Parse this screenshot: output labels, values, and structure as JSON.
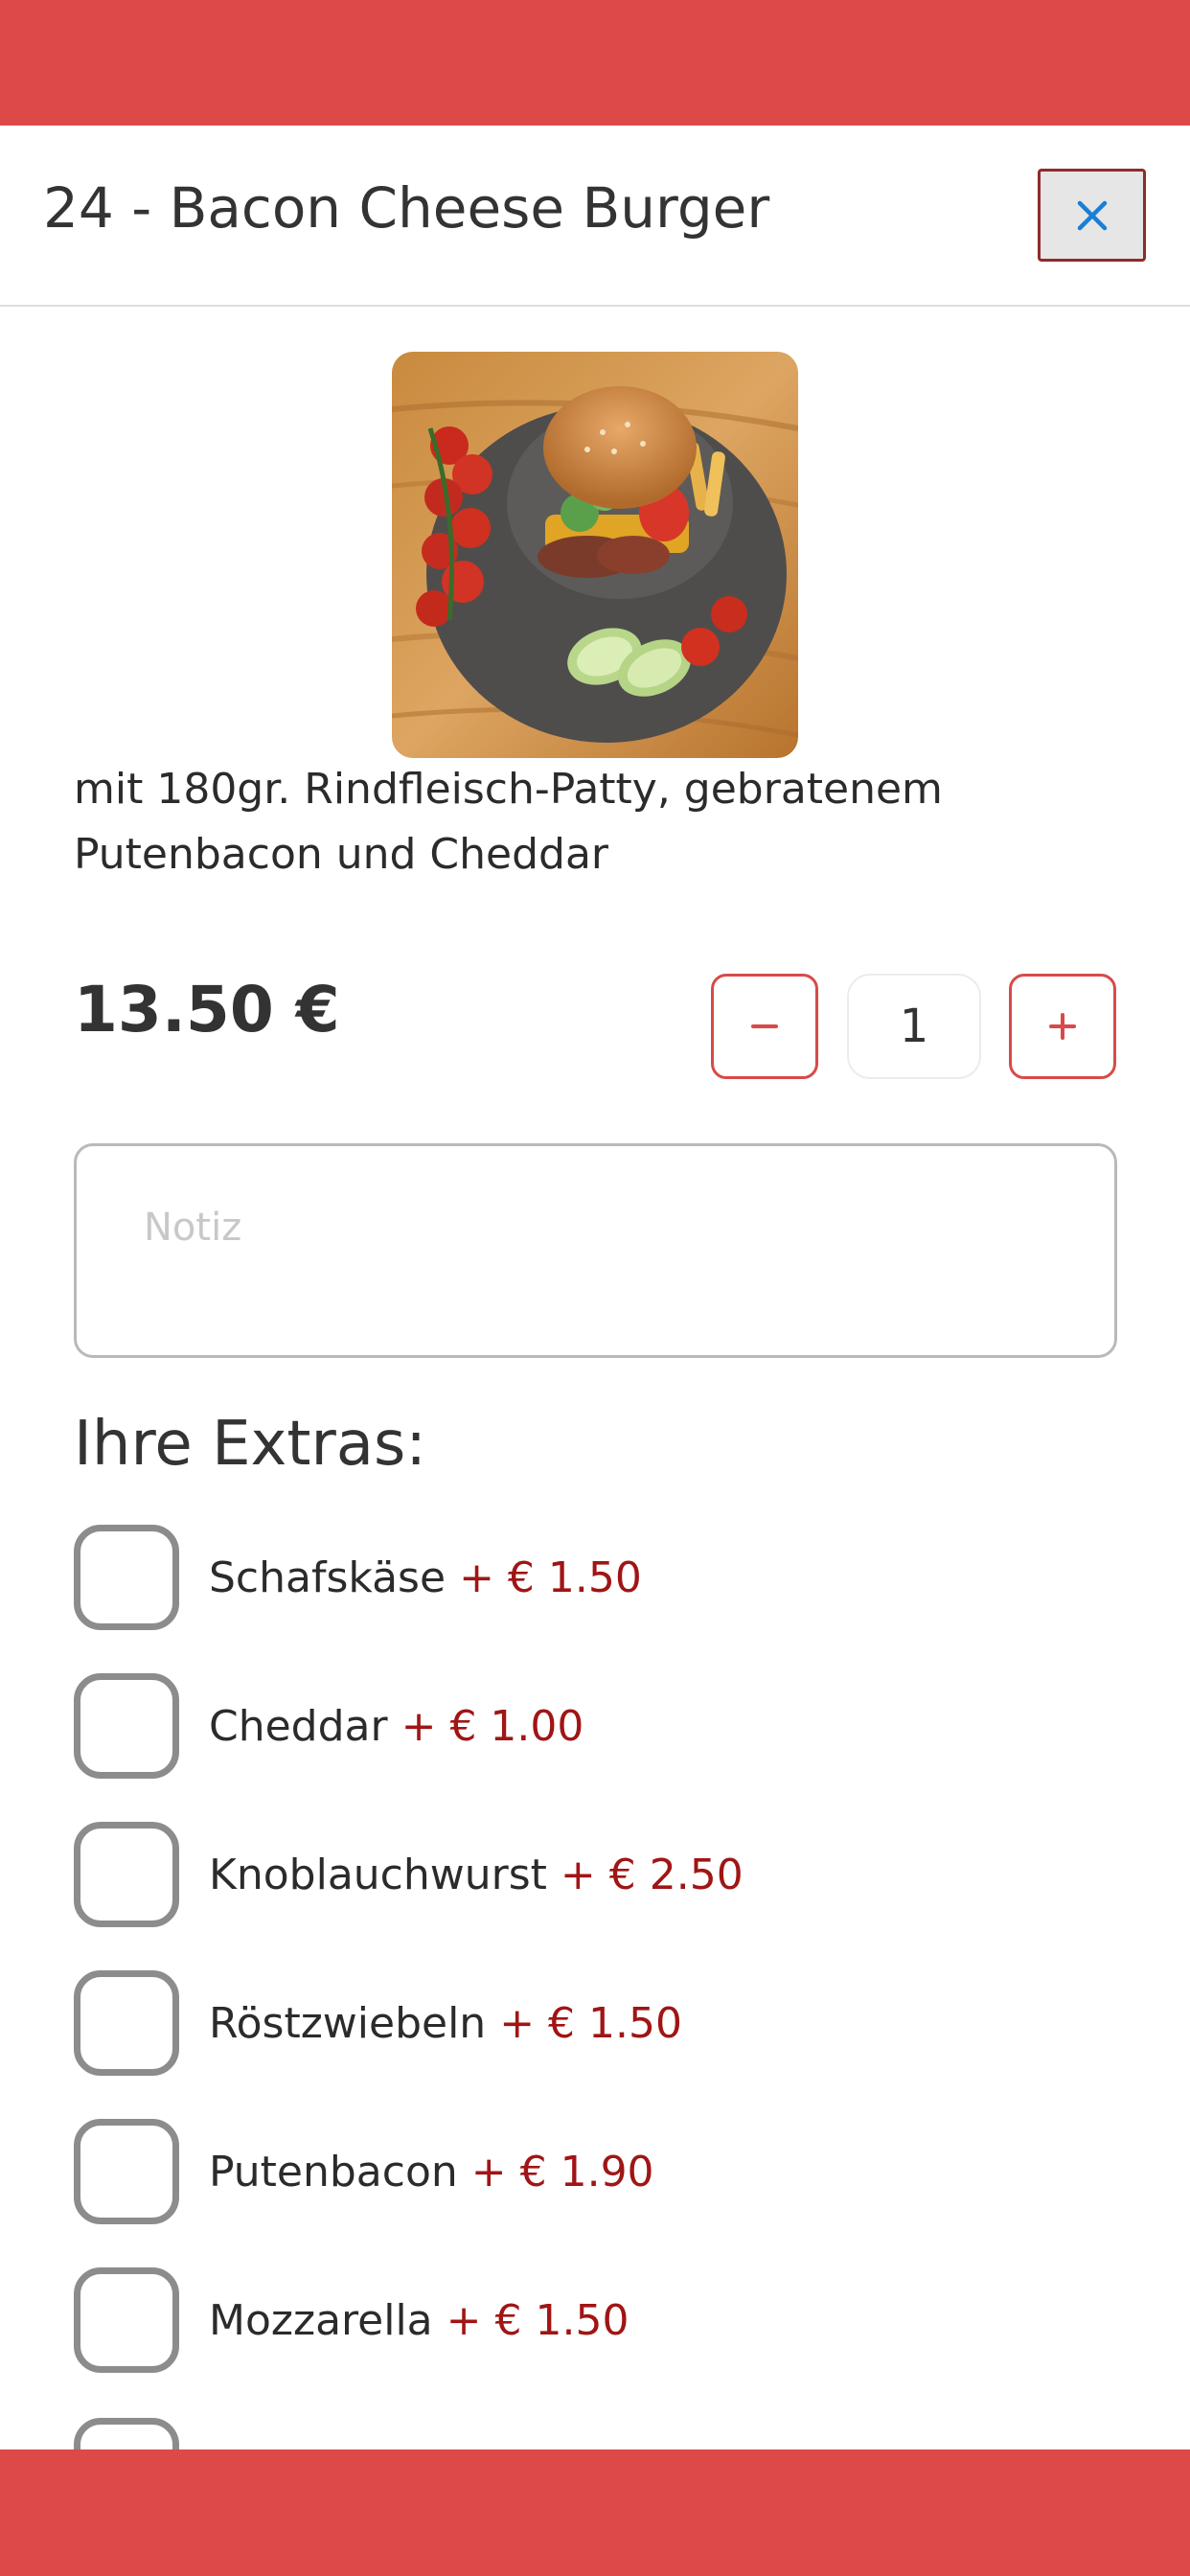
{
  "modal": {
    "title": "24 - Bacon Cheese Burger",
    "close_icon": "close-icon"
  },
  "product": {
    "description": "mit 180gr. Rindfleisch-Patty, gebratenem Putenbacon und Cheddar",
    "price": "13.50 €",
    "quantity": "1"
  },
  "note": {
    "placeholder": "Notiz",
    "value": ""
  },
  "extras": {
    "heading": "Ihre Extras:",
    "items": [
      {
        "label": "Schafskäse",
        "price": "+ € 1.50",
        "checked": false
      },
      {
        "label": "Cheddar",
        "price": "+ € 1.00",
        "checked": false
      },
      {
        "label": "Knoblauchwurst",
        "price": "+ € 2.50",
        "checked": false
      },
      {
        "label": "Röstzwiebeln",
        "price": "+ € 1.50",
        "checked": false
      },
      {
        "label": "Putenbacon",
        "price": "+ € 1.90",
        "checked": false
      },
      {
        "label": "Mozzarella",
        "price": "+ € 1.50",
        "checked": false
      }
    ]
  },
  "colors": {
    "brand_red": "#dd4848",
    "price_red": "#a01515",
    "close_icon_blue": "#1a7fd4"
  }
}
